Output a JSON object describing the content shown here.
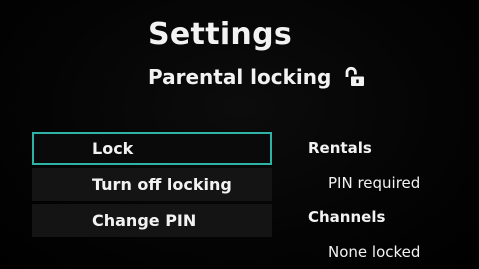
{
  "header": {
    "title": "Settings",
    "subtitle": "Parental locking",
    "status_icon": "unlocked-padlock-icon"
  },
  "menu": {
    "items": [
      {
        "label": "Lock",
        "selected": true
      },
      {
        "label": "Turn off locking",
        "selected": false
      },
      {
        "label": "Change PIN",
        "selected": false
      }
    ]
  },
  "info": {
    "rentals_heading": "Rentals",
    "rentals_value": "PIN required",
    "channels_heading": "Channels",
    "channels_value": "None locked"
  },
  "colors": {
    "background": "#030303",
    "selection_border": "#2fb3a6",
    "text": "#f2f2f2",
    "menu_item_bg": "#141414"
  }
}
